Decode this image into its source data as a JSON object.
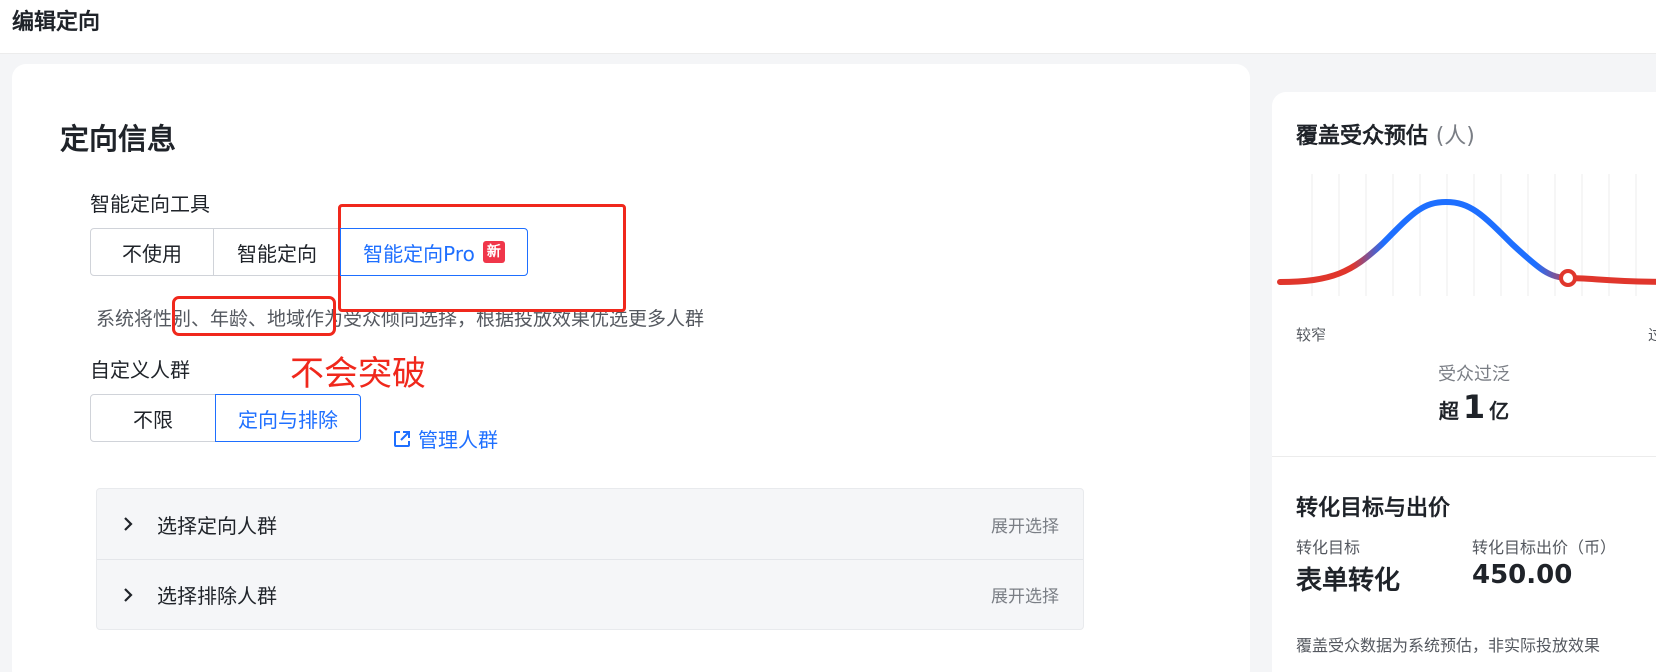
{
  "header": {
    "title": "编辑定向"
  },
  "main": {
    "section_title": "定向信息",
    "smart_tool": {
      "label": "智能定向工具",
      "options": [
        "不使用",
        "智能定向",
        "智能定向Pro"
      ],
      "selected": "智能定向Pro",
      "new_badge": "新",
      "hint": "系统将性别、年龄、地域作为受众倾向选择，根据投放效果优选更多人群"
    },
    "annotation": "不会突破",
    "custom_crowd": {
      "label": "自定义人群",
      "options": [
        "不限",
        "定向与排除"
      ],
      "selected": "定向与排除",
      "manage_link": "管理人群"
    },
    "panel": {
      "rows": [
        {
          "title": "选择定向人群",
          "action": "展开选择"
        },
        {
          "title": "选择排除人群",
          "action": "展开选择"
        }
      ]
    }
  },
  "sidebar": {
    "audience": {
      "title": "覆盖受众预估",
      "unit": "(人)",
      "axis_left": "较窄",
      "axis_right": "过",
      "status": "受众过泛",
      "estimate_prefix": "超",
      "estimate_value": "1",
      "estimate_unit": "亿",
      "colors": {
        "curve_good": "#1e6fff",
        "curve_edge": "#e0362c"
      }
    },
    "conversion": {
      "title": "转化目标与出价",
      "goal_label": "转化目标",
      "goal_value": "表单转化",
      "bid_label": "转化目标出价（币）",
      "bid_value": "450.00"
    },
    "note": "覆盖受众数据为系统预估，非实际投放效果"
  }
}
